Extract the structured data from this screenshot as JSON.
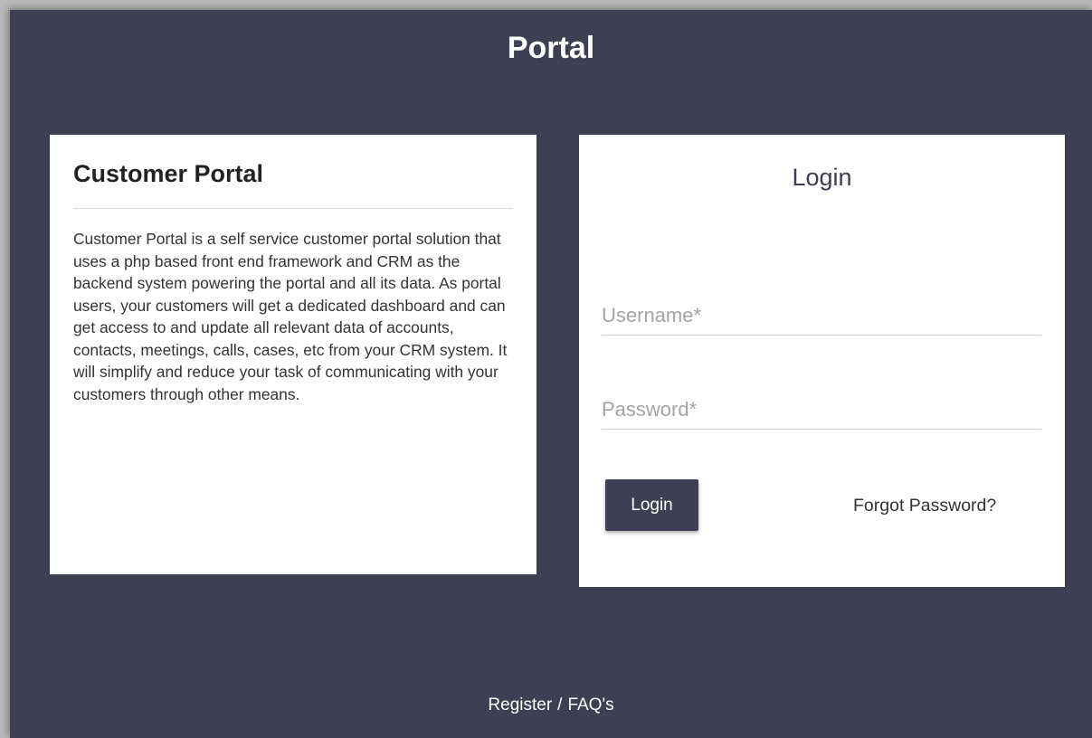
{
  "header": {
    "title": "Portal"
  },
  "info": {
    "title": "Customer Portal",
    "description": "Customer Portal is a self service customer portal solution that uses a php based front end framework and CRM as the backend system powering the portal and all its data. As portal users, your customers will get a dedicated dashboard and can get access to and update all relevant data of accounts, contacts, meetings, calls, cases, etc from your CRM system. It will simplify and reduce your task of communicating with your customers through other means."
  },
  "login": {
    "title": "Login",
    "username_placeholder": "Username*",
    "username_value": "",
    "password_placeholder": "Password*",
    "password_value": "",
    "button_label": "Login",
    "forgot_label": "Forgot Password?"
  },
  "footer": {
    "register_label": "Register",
    "separator": "/",
    "faq_label": "FAQ's"
  },
  "colors": {
    "background": "#3e3f52",
    "card": "#ffffff",
    "button": "#3e3f52"
  }
}
